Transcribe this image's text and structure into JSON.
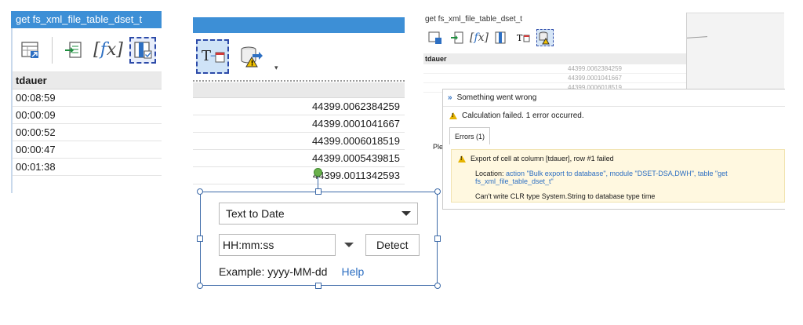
{
  "panel1": {
    "title": "get fs_xml_file_table_dset_t",
    "toolbar_icons": [
      "table-import-icon",
      "excel-export-icon",
      "function-icon",
      "column-select-icon"
    ],
    "fx_label": "[fx]",
    "column_header": "tdauer",
    "rows": [
      "00:08:59",
      "00:00:09",
      "00:00:52",
      "00:00:47",
      "00:01:38"
    ]
  },
  "panel2": {
    "toolbar_icons": [
      "text-to-date-icon",
      "export-warning-icon"
    ],
    "dropdown_mark": "▾",
    "values": [
      "44399.0062384259",
      "44399.0001041667",
      "44399.0006018519",
      "44399.0005439815",
      "44399.0011342593"
    ]
  },
  "popup": {
    "conversion": "Text to Date",
    "format": "HH:mm:ss",
    "detect_label": "Detect",
    "example_label": "Example: yyyy-MM-dd",
    "help_label": "Help"
  },
  "panel3": {
    "title": "get fs_xml_file_table_dset_t",
    "fx_label": "[fx]",
    "column_header": "tdauer",
    "values": [
      "44399.0062384259",
      "44399.0001041667",
      "44399.0006018519"
    ],
    "partial_label": "Ple"
  },
  "error_dialog": {
    "title": "Something went wrong",
    "summary": "Calculation failed. 1 error occurred.",
    "tab_label": "Errors (1)",
    "message": "Export of cell at column [tdauer], row #1 failed",
    "location_label": "Location:",
    "location_link": "action \"Bulk export to database\", module \"DSET-DSA,DWH\", table \"get fs_xml_file_table_dset_t\"",
    "detail": "Can't write CLR type System.String to database type time"
  },
  "colors": {
    "title_blue": "#3d8fd6",
    "link_blue": "#2d6fc2",
    "warning_yellow": "#e6b400",
    "error_bg": "#fff8e0"
  }
}
